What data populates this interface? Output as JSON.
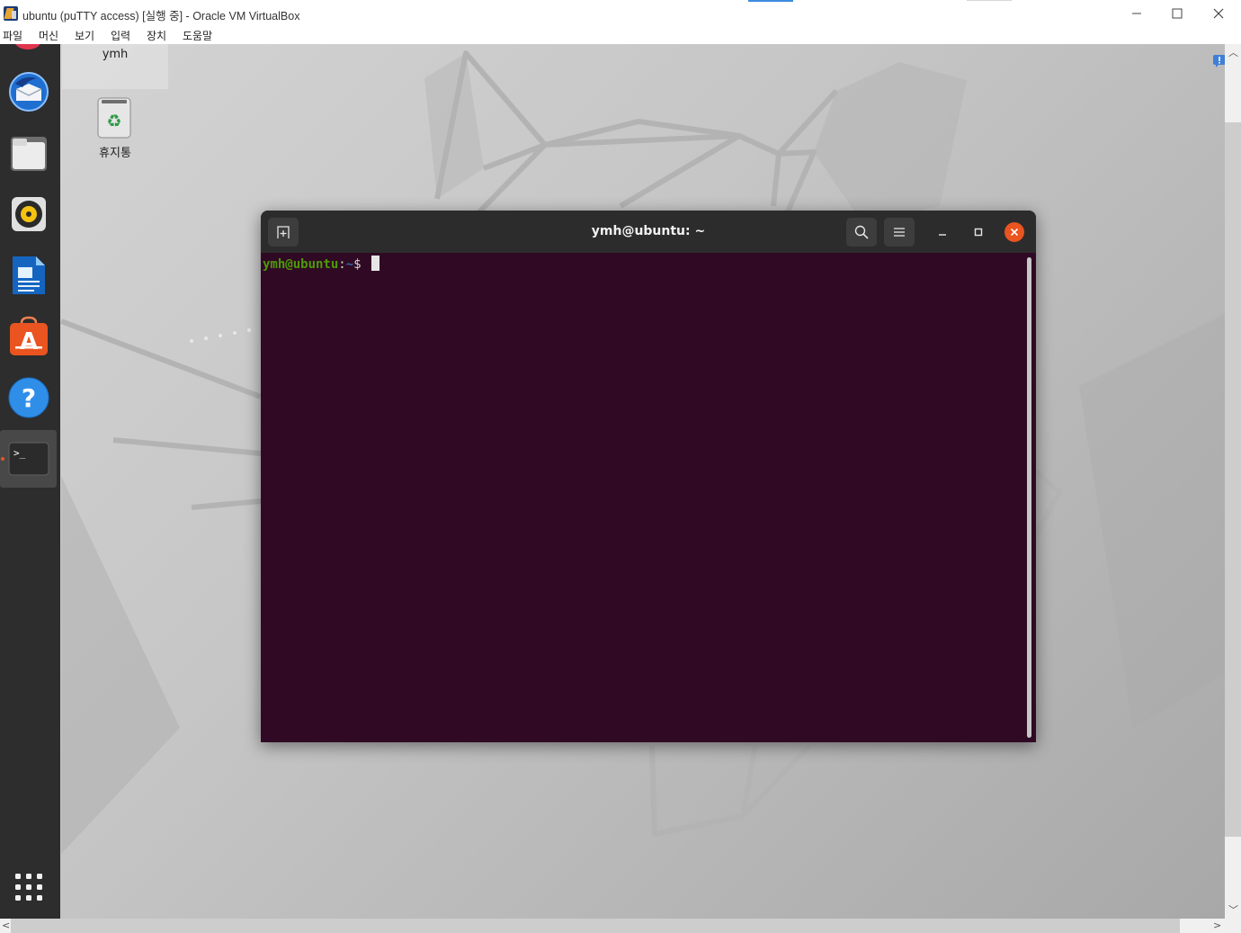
{
  "window": {
    "title": "ubuntu (puTTY access) [실행 중] - Oracle VM VirtualBox",
    "controls": {
      "minimize": "—",
      "maximize": "☐",
      "close": "✕"
    }
  },
  "menu": [
    "파일",
    "머신",
    "보기",
    "입력",
    "장치",
    "도움말"
  ],
  "desktop": {
    "home_label": "ymh",
    "trash_label": "휴지통"
  },
  "dock": {
    "items": [
      "thunderbird-icon",
      "files-icon",
      "rhythmbox-icon",
      "writer-icon",
      "software-icon",
      "help-icon",
      "terminal-icon"
    ],
    "apps_grid": "show-applications-icon"
  },
  "terminal": {
    "title": "ymh@ubuntu: ~",
    "prompt_user": "ymh@ubuntu",
    "prompt_colon": ":",
    "prompt_dir": "~",
    "prompt_dollar": "$ "
  },
  "colors": {
    "terminal_bg": "#300a24",
    "ubuntu_orange": "#e95420",
    "prompt_green": "#4e9a06",
    "prompt_blue": "#3465a4"
  }
}
